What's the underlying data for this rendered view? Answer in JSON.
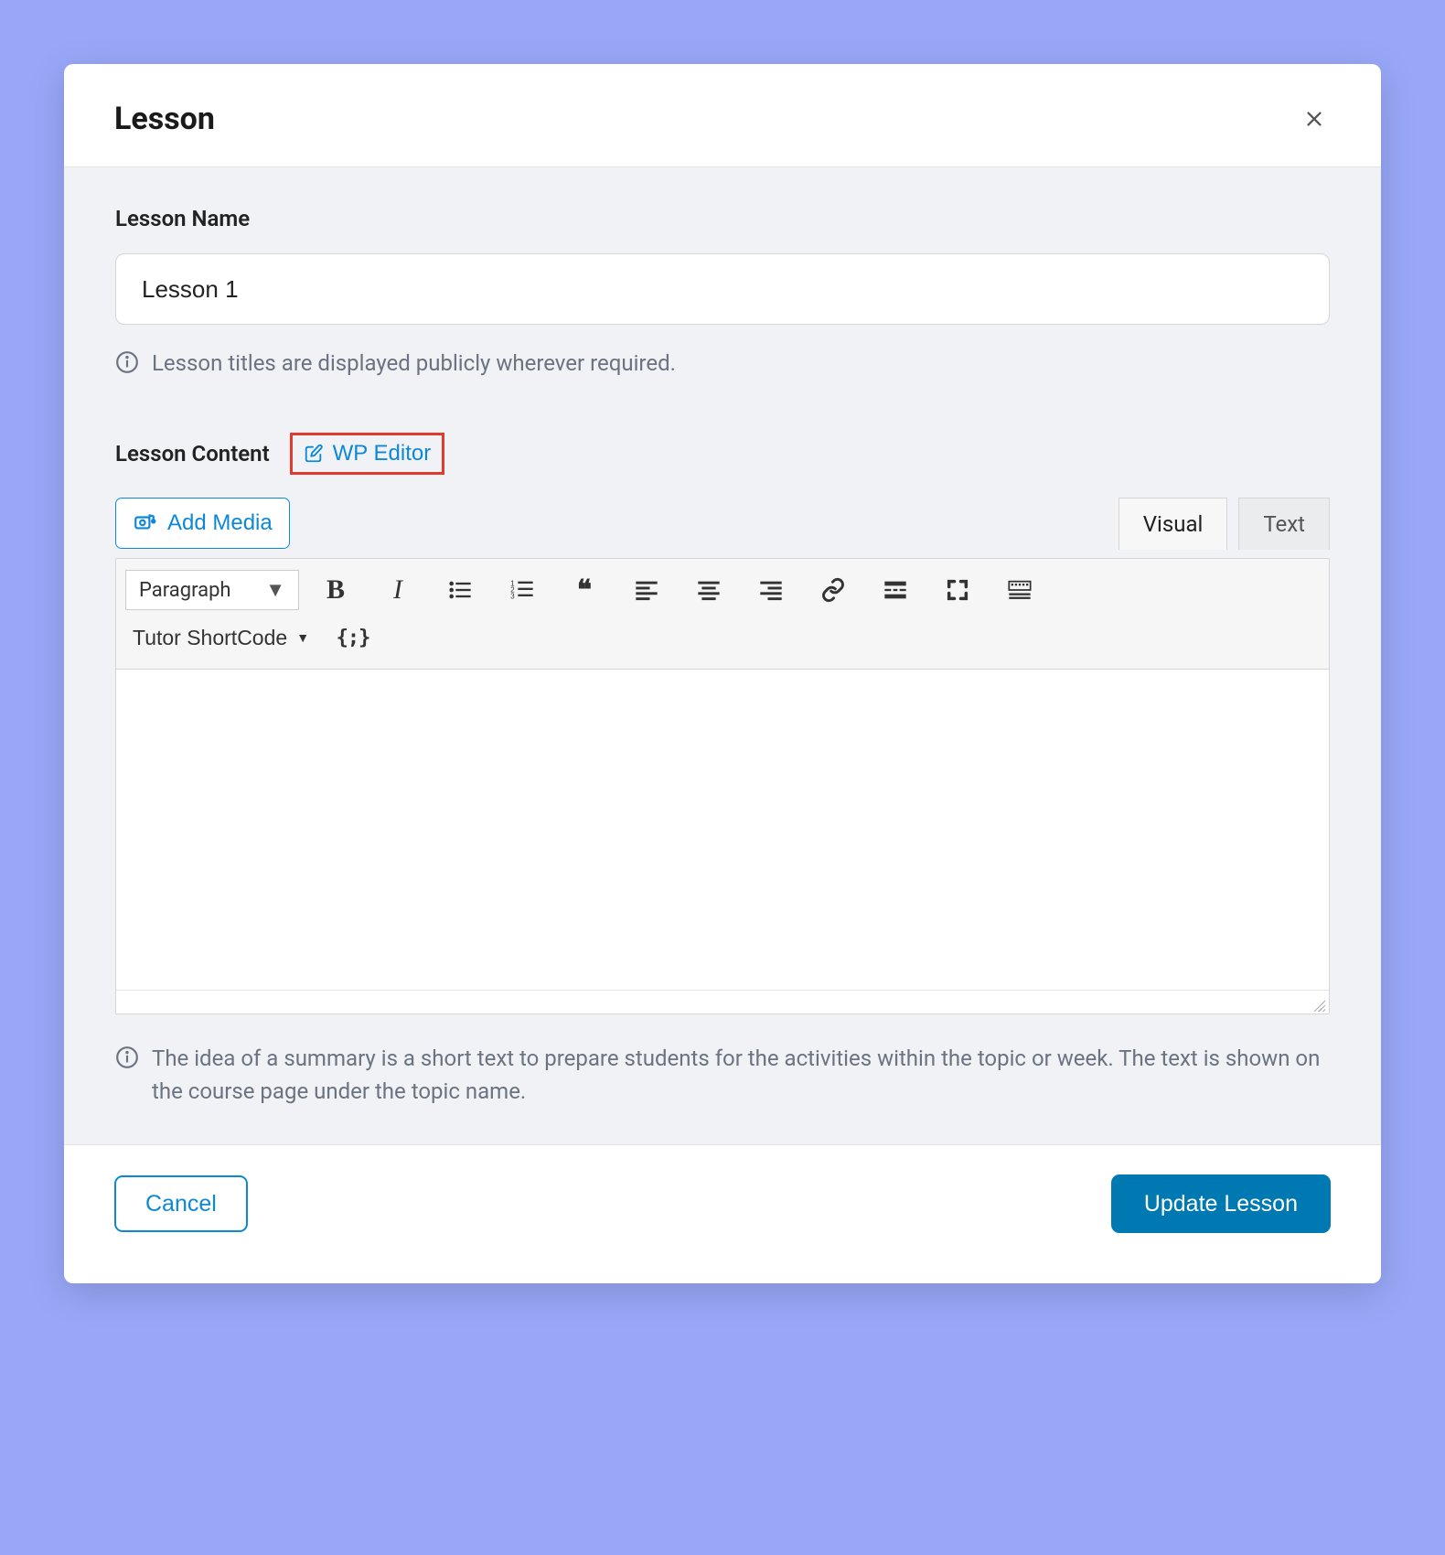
{
  "modal": {
    "title": "Lesson",
    "name_label": "Lesson Name",
    "name_value": "Lesson 1",
    "name_hint": "Lesson titles are displayed publicly wherever required.",
    "content_label": "Lesson Content",
    "wp_editor_label": "WP Editor",
    "add_media_label": "Add Media",
    "tabs": {
      "visual": "Visual",
      "text": "Text"
    },
    "format_select": "Paragraph",
    "shortcode_label": "Tutor ShortCode",
    "braces_label": "{;}",
    "content_hint": "The idea of a summary is a short text to prepare students for the activities within the topic or week. The text is shown on the course page under the topic name.",
    "cancel_label": "Cancel",
    "submit_label": "Update Lesson"
  }
}
